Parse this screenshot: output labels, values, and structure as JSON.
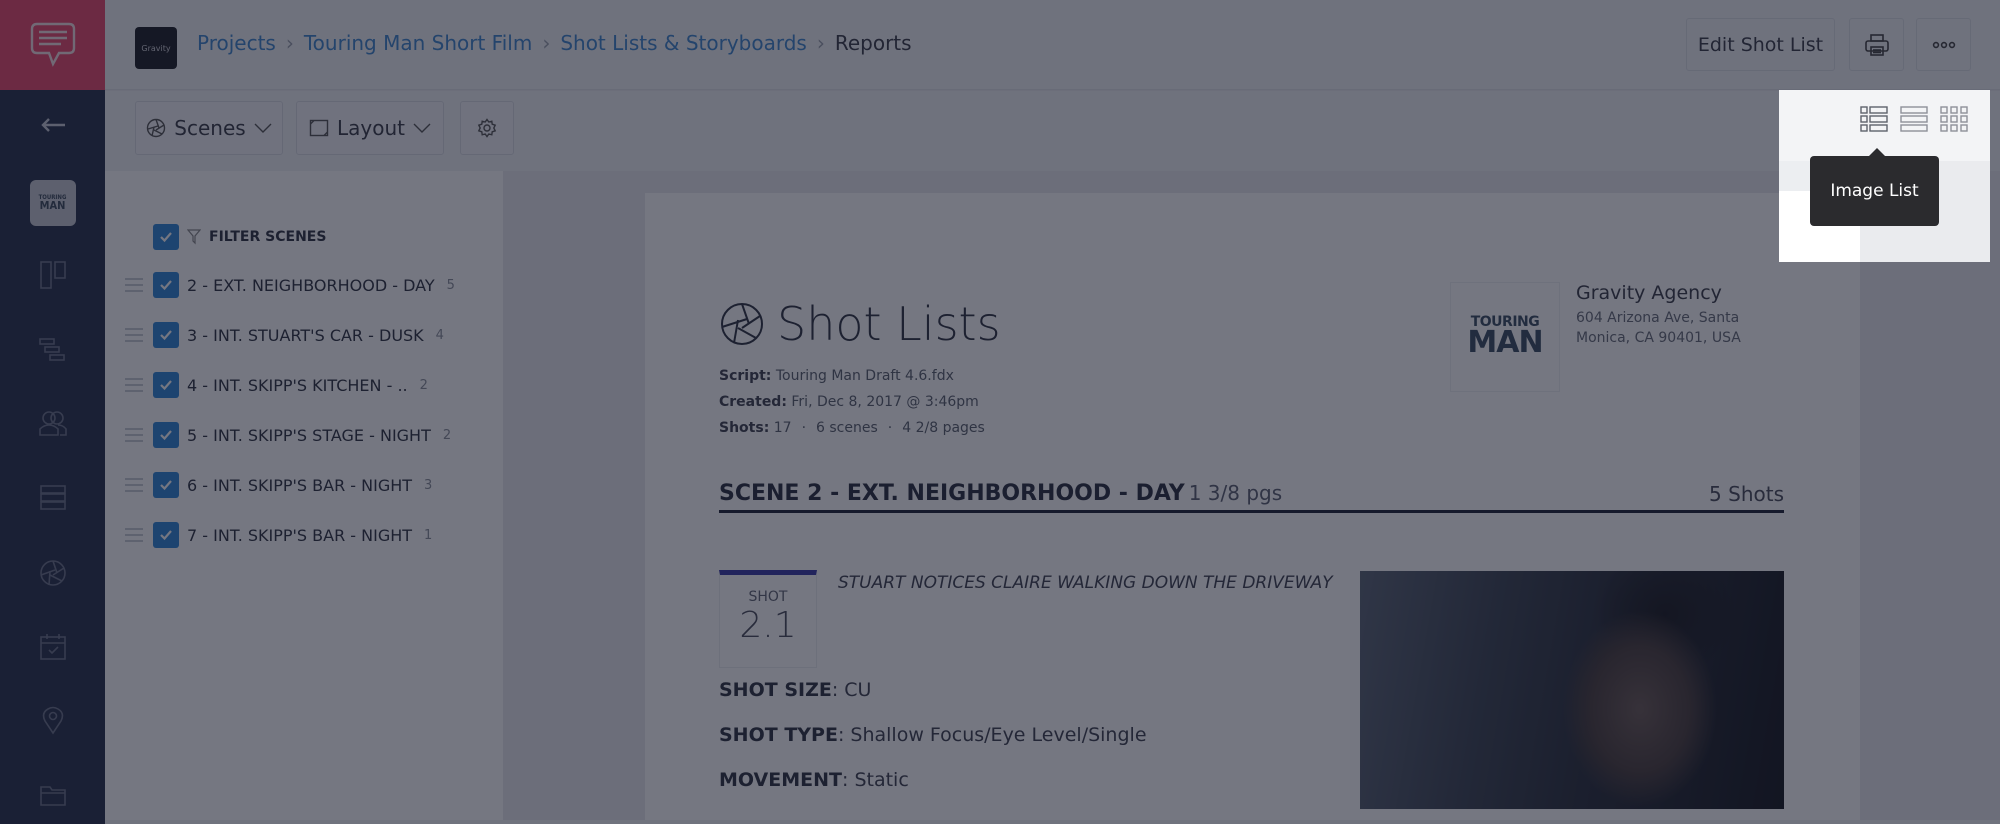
{
  "header": {
    "org_logo_text": "Gravity",
    "breadcrumb": [
      {
        "label": "Projects"
      },
      {
        "label": "Touring Man Short Film"
      },
      {
        "label": "Shot Lists & Storyboards"
      },
      {
        "label": "Reports"
      }
    ],
    "edit_button": "Edit Shot List",
    "print_icon": "printer-icon",
    "more_icon": "more-dots-icon"
  },
  "sidebar": {
    "logo_icon": "speech-bubble-logo-icon",
    "back_icon": "arrow-left-icon",
    "project_thumb": {
      "line1": "TOURING",
      "line2": "MAN"
    },
    "items": [
      {
        "icon": "storyboard-icon"
      },
      {
        "icon": "schedule-stripboard-icon"
      },
      {
        "icon": "cast-icon"
      },
      {
        "icon": "breakdown-list-icon"
      },
      {
        "icon": "shot-list-aperture-icon"
      },
      {
        "icon": "calendar-check-icon"
      },
      {
        "icon": "location-pin-icon"
      },
      {
        "icon": "folder-icon"
      }
    ]
  },
  "toolbar": {
    "scenes_label": "Scenes",
    "layout_label": "Layout",
    "settings_icon": "gear-icon"
  },
  "filter": {
    "header": "FILTER SCENES",
    "checked": true,
    "scenes": [
      {
        "label": "2 - EXT. NEIGHBORHOOD - DAY",
        "count": "5",
        "checked": true
      },
      {
        "label": "3 - INT. STUART'S CAR - DUSK",
        "count": "4",
        "checked": true
      },
      {
        "label": "4 - INT. SKIPP'S KITCHEN - ..",
        "count": "2",
        "checked": true
      },
      {
        "label": "5 - INT. SKIPP'S STAGE - NIGHT",
        "count": "2",
        "checked": true
      },
      {
        "label": "6 - INT. SKIPP'S BAR - NIGHT",
        "count": "3",
        "checked": true
      },
      {
        "label": "7 - INT. SKIPP'S BAR - NIGHT",
        "count": "1",
        "checked": true
      }
    ]
  },
  "document": {
    "title": "Shot Lists",
    "script_label": "Script:",
    "script_value": "Touring Man Draft 4.6.fdx",
    "created_label": "Created:",
    "created_value": "Fri, Dec 8, 2017 @ 3:46pm",
    "shots_label": "Shots:",
    "shots_value": "17",
    "scenes_count": "6 scenes",
    "pages_count": "4 2/8 pages",
    "company": {
      "logo_line1": "TOURING",
      "logo_line2": "MAN",
      "name": "Gravity Agency",
      "address_line1": "604 Arizona Ave, Santa",
      "address_line2": "Monica, CA 90401, USA"
    },
    "scene": {
      "title": "SCENE 2 - EXT. NEIGHBORHOOD - DAY",
      "pages": "1 3/8 pgs",
      "shots": "5 Shots",
      "shot": {
        "label": "SHOT",
        "number": "2.1",
        "description": "STUART NOTICES CLAIRE WALKING DOWN THE DRIVEWAY",
        "fields": [
          {
            "label": "SHOT SIZE",
            "value": "CU"
          },
          {
            "label": "SHOT TYPE",
            "value": "Shallow Focus/Eye Level/Single"
          },
          {
            "label": "MOVEMENT",
            "value": "Static"
          }
        ],
        "accent_color": "#3b3ba8"
      }
    }
  },
  "view_switcher": {
    "options": [
      {
        "name": "image-list",
        "icon": "image-list-icon",
        "active": true
      },
      {
        "name": "list",
        "icon": "list-icon",
        "active": false
      },
      {
        "name": "grid",
        "icon": "grid-icon",
        "active": false
      }
    ],
    "tooltip": "Image List"
  },
  "colors": {
    "brand": "#e9486b",
    "nav_bg": "#28304a",
    "link": "#3f86cd",
    "checkbox": "#2f86d6"
  }
}
